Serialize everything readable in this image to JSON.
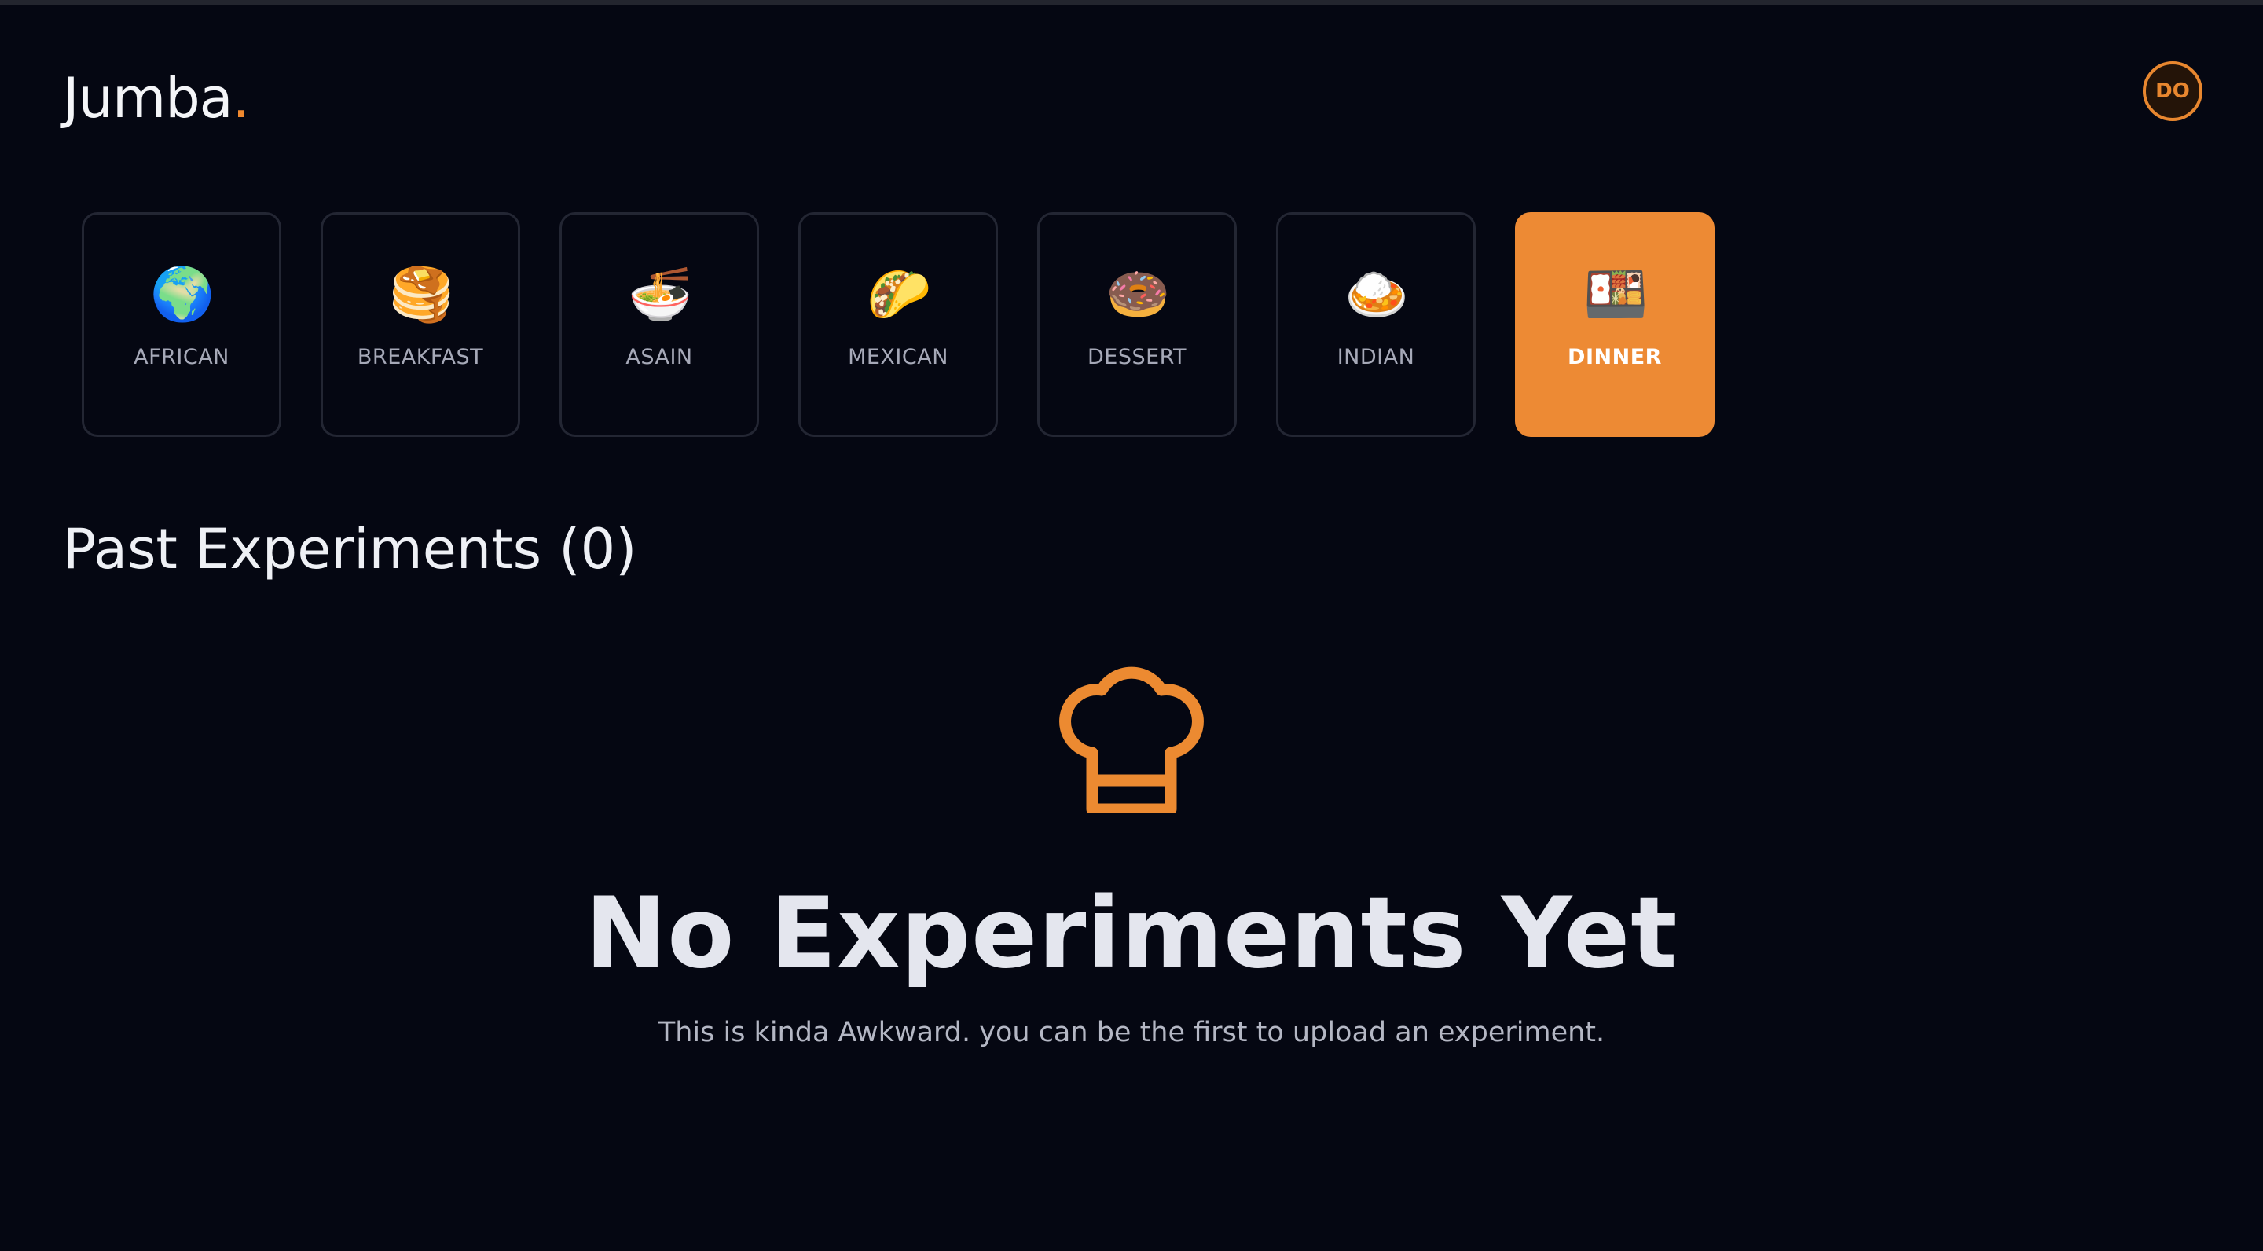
{
  "brand": {
    "name": "Jumba",
    "dot": ".",
    "dot_color": "#f0892f"
  },
  "user": {
    "initials": "DO"
  },
  "accent_color": "#ed8a34",
  "categories": [
    {
      "label": "AFRICAN",
      "icon": "globe-africa-icon",
      "emoji": "🌍",
      "active": false
    },
    {
      "label": "BREAKFAST",
      "icon": "pancakes-icon",
      "emoji": "🥞",
      "active": false
    },
    {
      "label": "ASAIN",
      "icon": "noodle-bowl-icon",
      "emoji": "🍜",
      "active": false
    },
    {
      "label": "MEXICAN",
      "icon": "taco-icon",
      "emoji": "🌮",
      "active": false
    },
    {
      "label": "DESSERT",
      "icon": "doughnut-icon",
      "emoji": "🍩",
      "active": false
    },
    {
      "label": "INDIAN",
      "icon": "curry-rice-icon",
      "emoji": "🍛",
      "active": false
    },
    {
      "label": "DINNER",
      "icon": "bento-box-icon",
      "emoji": "🍱",
      "active": true
    }
  ],
  "past_experiments": {
    "title": "Past Experiments (0)"
  },
  "empty_state": {
    "icon": "chef-hat-icon",
    "title": "No Experiments Yet",
    "subtitle": "This is kinda Awkward. you can be the first to upload an experiment."
  }
}
